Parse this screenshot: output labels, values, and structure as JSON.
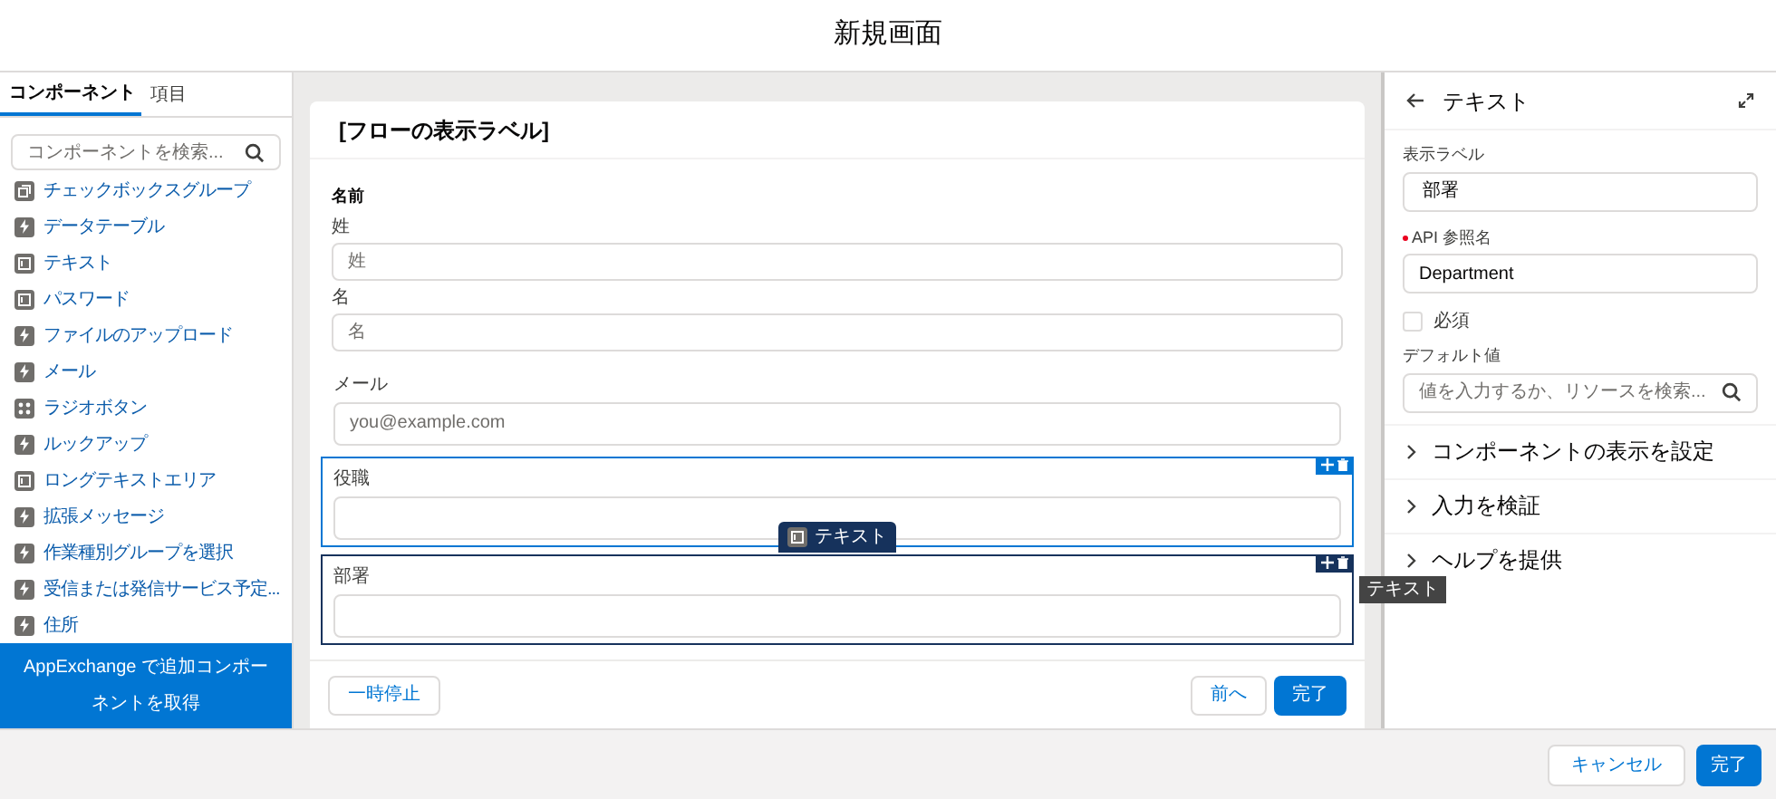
{
  "header": {
    "title": "新規画面"
  },
  "sidebar": {
    "tabs": [
      {
        "label": "コンポーネント",
        "selected": true
      },
      {
        "label": "項目",
        "selected": false
      }
    ],
    "search": {
      "placeholder": "コンポーネントを検索..."
    },
    "items": [
      {
        "label": "チェックボックスグループ",
        "kind": "checkbox"
      },
      {
        "label": "データテーブル",
        "kind": "flow"
      },
      {
        "label": "テキスト",
        "kind": "input"
      },
      {
        "label": "パスワード",
        "kind": "input"
      },
      {
        "label": "ファイルのアップロード",
        "kind": "flow"
      },
      {
        "label": "メール",
        "kind": "flow"
      },
      {
        "label": "ラジオボタン",
        "kind": "radio"
      },
      {
        "label": "ルックアップ",
        "kind": "flow"
      },
      {
        "label": "ロングテキストエリア",
        "kind": "input"
      },
      {
        "label": "拡張メッセージ",
        "kind": "flow"
      },
      {
        "label": "作業種別グループを選択",
        "kind": "flow"
      },
      {
        "label": "受信または発信サービス予定...",
        "kind": "flow"
      },
      {
        "label": "住所",
        "kind": "flow"
      }
    ],
    "appexchange_button": "AppExchange で追加コンポーネントを取得"
  },
  "canvas": {
    "title": "[フローの表示ラベル]",
    "name_group": {
      "label": "名前",
      "fields": [
        {
          "label": "姓",
          "placeholder": "姓"
        },
        {
          "label": "名",
          "placeholder": "名"
        }
      ]
    },
    "fields": [
      {
        "label": "メール",
        "placeholder": "you@example.com",
        "hovered": false,
        "selected": false
      },
      {
        "label": "役職",
        "hovered": true,
        "selected": false
      },
      {
        "label": "部署",
        "hovered": false,
        "selected": true
      }
    ],
    "drag_badge": "テキスト",
    "tooltip": "テキスト",
    "pause_button": "一時停止",
    "previous_button": "前へ",
    "finish_button": "完了"
  },
  "properties": {
    "title": "テキスト",
    "label_field": {
      "label": "表示ラベル",
      "value": "部署"
    },
    "api_field": {
      "label": "API 参照名",
      "value": "Department",
      "required": true
    },
    "required_checkbox": {
      "label": "必須",
      "checked": false
    },
    "default_field": {
      "label": "デフォルト値",
      "placeholder": "値を入力するか、リソースを検索..."
    },
    "sections": [
      {
        "label": "コンポーネントの表示を設定",
        "expanded": false
      },
      {
        "label": "入力を検証",
        "expanded": false
      },
      {
        "label": "ヘルプを提供",
        "expanded": false
      }
    ]
  },
  "footer": {
    "cancel_button": "キャンセル",
    "done_button": "完了"
  }
}
